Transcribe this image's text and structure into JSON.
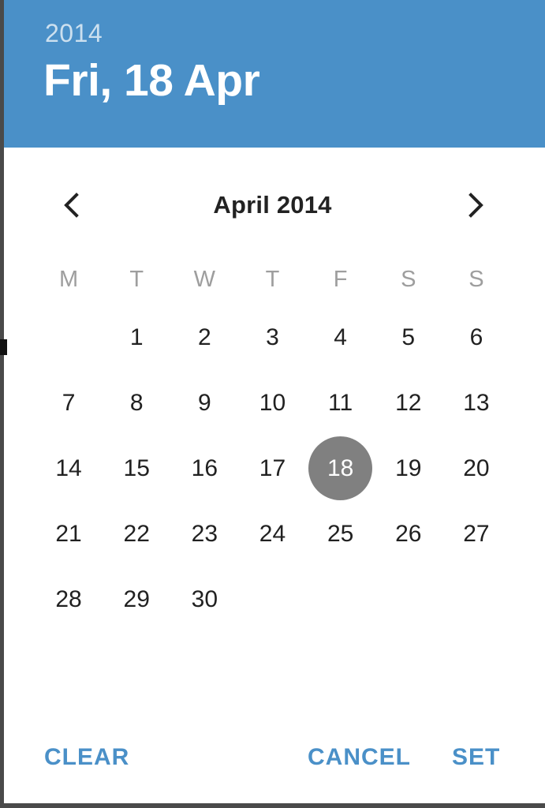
{
  "header": {
    "year": "2014",
    "date": "Fri, 18 Apr",
    "background_color": "#4a90c8",
    "text_color": "#ffffff"
  },
  "month_nav": {
    "prev_icon": "chevron-left-icon",
    "next_icon": "chevron-right-icon",
    "label": "April 2014"
  },
  "calendar": {
    "weekdays": [
      "M",
      "T",
      "W",
      "T",
      "F",
      "S",
      "S"
    ],
    "weeks": [
      [
        "",
        "1",
        "2",
        "3",
        "4",
        "5",
        "6"
      ],
      [
        "7",
        "8",
        "9",
        "10",
        "11",
        "12",
        "13"
      ],
      [
        "14",
        "15",
        "16",
        "17",
        "18",
        "19",
        "20"
      ],
      [
        "21",
        "22",
        "23",
        "24",
        "25",
        "26",
        "27"
      ],
      [
        "28",
        "29",
        "30",
        "",
        "",
        "",
        ""
      ]
    ],
    "selected_day": "18",
    "selected_color": "#808080",
    "selected_text_color": "#ffffff",
    "day_text_color": "#212121",
    "weekday_text_color": "#9e9e9e"
  },
  "actions": {
    "clear_label": "CLEAR",
    "cancel_label": "CANCEL",
    "set_label": "SET",
    "color": "#4a90c8"
  },
  "chart_data": {
    "type": "table",
    "title": "April 2014",
    "categories": [
      "M",
      "T",
      "W",
      "T",
      "F",
      "S",
      "S"
    ],
    "values": [
      [
        "",
        "1",
        "2",
        "3",
        "4",
        "5",
        "6"
      ],
      [
        "7",
        "8",
        "9",
        "10",
        "11",
        "12",
        "13"
      ],
      [
        "14",
        "15",
        "16",
        "17",
        "18",
        "19",
        "20"
      ],
      [
        "21",
        "22",
        "23",
        "24",
        "25",
        "26",
        "27"
      ],
      [
        "28",
        "29",
        "30",
        "",
        "",
        "",
        ""
      ]
    ]
  }
}
